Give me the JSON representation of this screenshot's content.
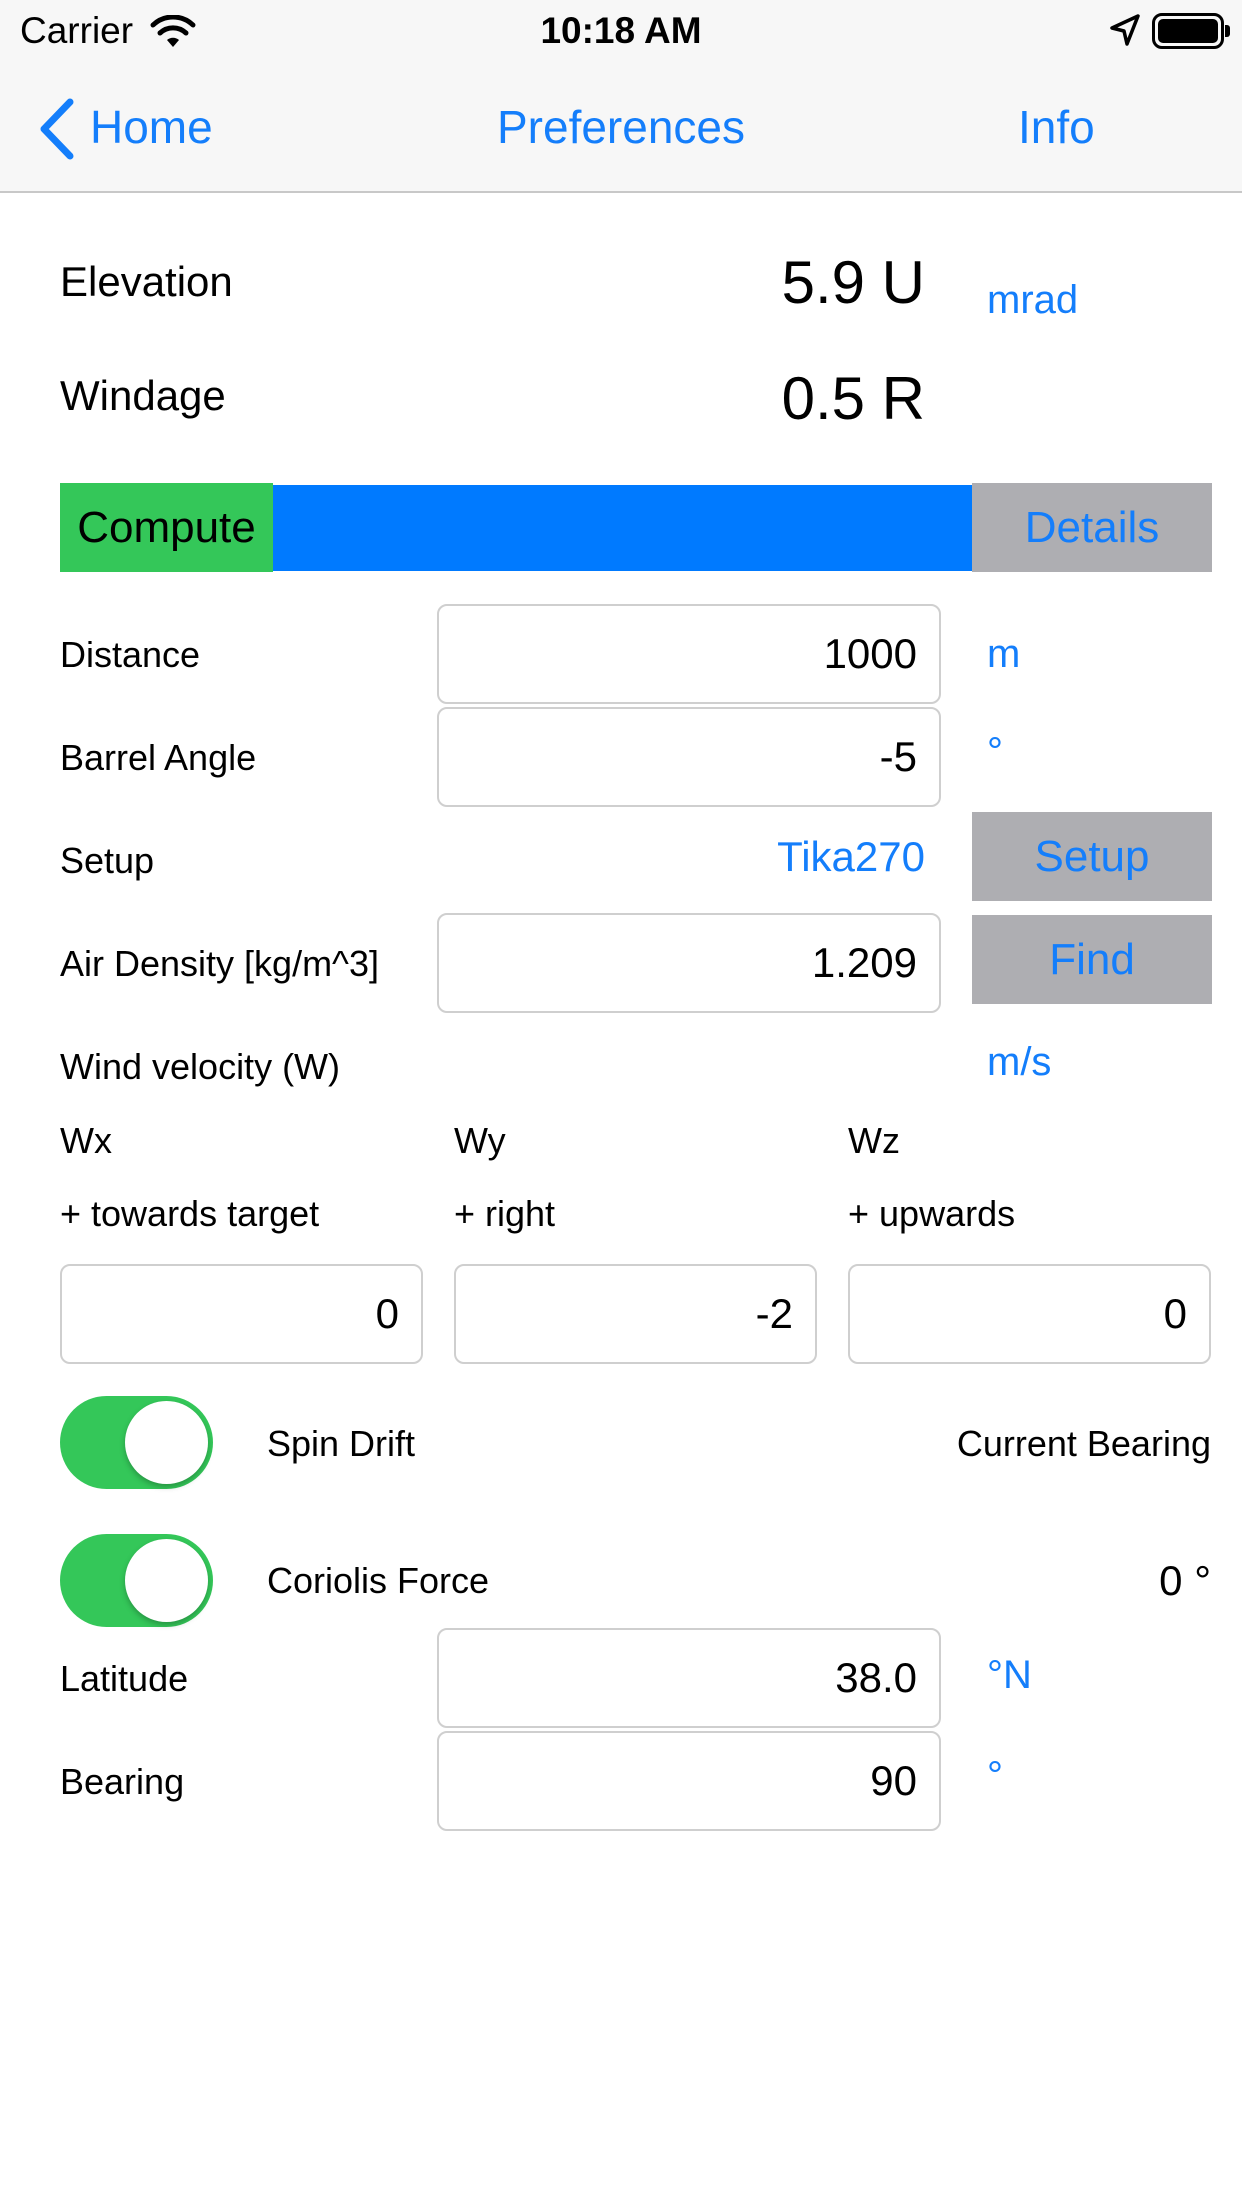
{
  "status_bar": {
    "carrier": "Carrier",
    "time": "10:18 AM"
  },
  "nav": {
    "back_label": "Home",
    "center_label": "Preferences",
    "right_label": "Info"
  },
  "results": {
    "elevation_label": "Elevation",
    "elevation_value": "5.9 U",
    "windage_label": "Windage",
    "windage_value": "0.5 R",
    "unit": "mrad"
  },
  "actions": {
    "compute_label": "Compute",
    "details_label": "Details"
  },
  "distance": {
    "label": "Distance",
    "value": "1000",
    "unit": "m"
  },
  "barrel_angle": {
    "label": "Barrel Angle",
    "value": "-5",
    "unit": "°"
  },
  "setup": {
    "label": "Setup",
    "value": "Tika270",
    "button_label": "Setup"
  },
  "air_density": {
    "label": "Air Density [kg/m^3]",
    "value": "1.209",
    "button_label": "Find"
  },
  "wind": {
    "label": "Wind velocity (W)",
    "unit": "m/s",
    "wx": {
      "label": "Wx",
      "hint": "+ towards target",
      "value": "0"
    },
    "wy": {
      "label": "Wy",
      "hint": "+ right",
      "value": "-2"
    },
    "wz": {
      "label": "Wz",
      "hint": "+ upwards",
      "value": "0"
    }
  },
  "spin_drift": {
    "label": "Spin Drift",
    "on": true
  },
  "coriolis": {
    "label": "Coriolis Force",
    "on": true
  },
  "current_bearing": {
    "label": "Current Bearing",
    "value": "0 °"
  },
  "latitude": {
    "label": "Latitude",
    "value": "38.0",
    "unit": "°N"
  },
  "bearing": {
    "label": "Bearing",
    "value": "90",
    "unit": "°"
  },
  "colors": {
    "accent": "#147efb",
    "compute_green": "#34c759",
    "progress_blue": "#007aff",
    "button_gray": "#aeaeb2"
  }
}
